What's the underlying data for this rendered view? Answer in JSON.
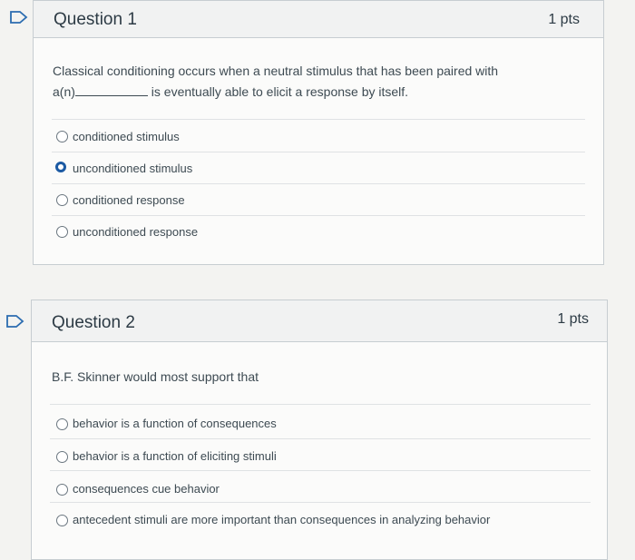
{
  "questions": [
    {
      "title": "Question 1",
      "points": "1 pts",
      "prompt_part1": "Classical conditioning occurs when a neutral stimulus that has been paired with",
      "prompt_part2_prefix": "a(n)",
      "prompt_part2_suffix": "is eventually able to elicit a response by itself.",
      "answers": [
        {
          "label": "conditioned stimulus",
          "selected": false
        },
        {
          "label": "unconditioned stimulus",
          "selected": true
        },
        {
          "label": "conditioned response",
          "selected": false
        },
        {
          "label": "unconditioned response",
          "selected": false
        }
      ]
    },
    {
      "title": "Question 2",
      "points": "1 pts",
      "prompt": "B.F. Skinner would most support that",
      "answers": [
        {
          "label": "behavior is a function of consequences",
          "selected": false
        },
        {
          "label": "behavior is a function of eliciting stimuli",
          "selected": false
        },
        {
          "label": "consequences cue behavior",
          "selected": false
        },
        {
          "label": "antecedent stimuli are more important than consequences in analyzing behavior",
          "selected": false
        }
      ]
    }
  ],
  "colors": {
    "selected_radio": "#1c5aa3",
    "flag": "#2b6cb0"
  },
  "icons": {
    "flag": "flag-icon"
  }
}
